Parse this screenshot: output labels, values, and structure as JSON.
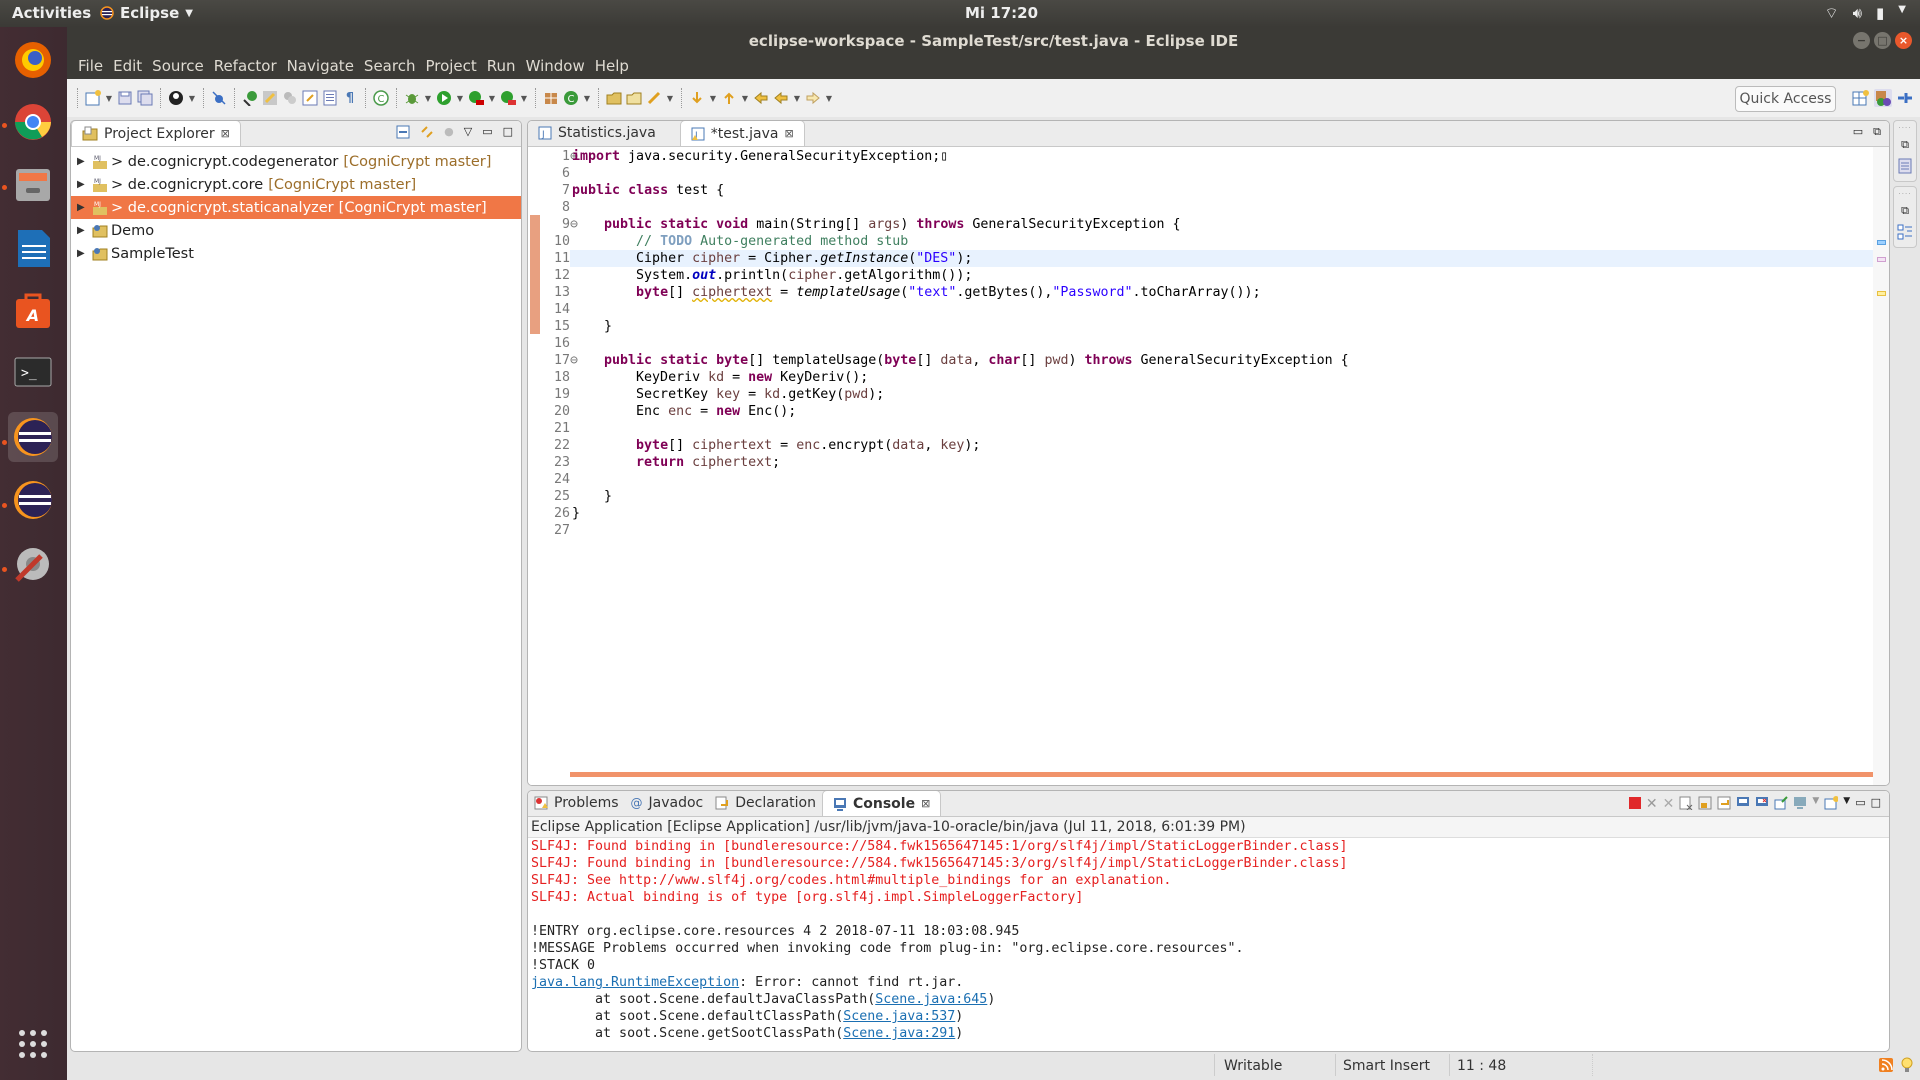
{
  "topbar": {
    "activities": "Activities",
    "app_name": "Eclipse",
    "clock": "Mi 17:20",
    "tray": [
      "wifi-icon",
      "volume-icon",
      "battery-icon",
      "system-menu-icon"
    ]
  },
  "dock": {
    "items": [
      {
        "name": "firefox",
        "running": false,
        "active": false,
        "color": "#e66000"
      },
      {
        "name": "chrome",
        "running": true,
        "active": false,
        "color": "#4285f4"
      },
      {
        "name": "files",
        "running": true,
        "active": false,
        "color": "#9a9a9a"
      },
      {
        "name": "libreoffice-writer",
        "running": false,
        "active": false,
        "color": "#1e6fb7"
      },
      {
        "name": "software-center",
        "running": false,
        "active": false,
        "color": "#e95420"
      },
      {
        "name": "terminal",
        "running": false,
        "active": false,
        "color": "#2b2b2b"
      },
      {
        "name": "eclipse",
        "running": true,
        "active": true,
        "color": "#2c2255"
      },
      {
        "name": "eclipse-2",
        "running": true,
        "active": false,
        "color": "#2c2255"
      },
      {
        "name": "system-tools",
        "running": true,
        "active": false,
        "color": "#c0392b"
      }
    ],
    "show_apps": "show-applications-icon"
  },
  "window": {
    "title": "eclipse-workspace - SampleTest/src/test.java - Eclipse IDE"
  },
  "menu": [
    "File",
    "Edit",
    "Source",
    "Refactor",
    "Navigate",
    "Search",
    "Project",
    "Run",
    "Window",
    "Help"
  ],
  "toolbar": {
    "quick_access": "Quick Access"
  },
  "explorer": {
    "title": "Project Explorer",
    "items": [
      {
        "label": "> de.cognicrypt.codegenerator",
        "branch": "[CogniCrypt master]",
        "selected": false
      },
      {
        "label": "> de.cognicrypt.core",
        "branch": "[CogniCrypt master]",
        "selected": false
      },
      {
        "label": "> de.cognicrypt.staticanalyzer",
        "branch": "[CogniCrypt master]",
        "selected": true
      },
      {
        "label": "Demo",
        "branch": "",
        "selected": false
      },
      {
        "label": "SampleTest",
        "branch": "",
        "selected": false
      }
    ]
  },
  "editor": {
    "tabs": [
      {
        "label": "Statistics.java",
        "active": false
      },
      {
        "label": "*test.java",
        "active": true
      }
    ],
    "lines": [
      {
        "n": "1",
        "fold": "+",
        "html": "<span class='kw'>import</span> java.security.GeneralSecurityException;▯"
      },
      {
        "n": "6",
        "html": ""
      },
      {
        "n": "7",
        "html": "<span class='kw'>public</span> <span class='kw'>class</span> test {"
      },
      {
        "n": "8",
        "html": ""
      },
      {
        "n": "9",
        "fold": "-",
        "html": "    <span class='kw'>public</span> <span class='kw'>static</span> <span class='kw'>void</span> main(String[] <span class='var'>args</span>) <span class='kw'>throws</span> GeneralSecurityException {"
      },
      {
        "n": "10",
        "html": "        <span class='cm'>// <span class='todo'>TODO</span> Auto-generated method stub</span>"
      },
      {
        "n": "11",
        "cur": true,
        "html": "        Cipher <span class='var'>cipher</span> = Cipher.<span class='it'>getInstance</span>(<span class='str'>\"DES\"</span>);"
      },
      {
        "n": "12",
        "html": "        System.<span class='fld'>out</span>.println(<span class='var'>cipher</span>.getAlgorithm());"
      },
      {
        "n": "13",
        "html": "        <span class='kw'>byte</span>[] <span class='var warn'>ciphertext</span> = <span class='it'>templateUsage</span>(<span class='str'>\"text\"</span>.getBytes(),<span class='str'>\"Password\"</span>.toCharArray());"
      },
      {
        "n": "14",
        "html": ""
      },
      {
        "n": "15",
        "html": "    }"
      },
      {
        "n": "16",
        "html": ""
      },
      {
        "n": "17",
        "fold": "-",
        "html": "    <span class='kw'>public</span> <span class='kw'>static</span> <span class='kw'>byte</span>[] templateUsage(<span class='kw'>byte</span>[] <span class='var'>data</span>, <span class='kw'>char</span>[] <span class='var'>pwd</span>) <span class='kw'>throws</span> GeneralSecurityException {"
      },
      {
        "n": "18",
        "html": "        KeyDeriv <span class='var'>kd</span> = <span class='kw'>new</span> KeyDeriv();"
      },
      {
        "n": "19",
        "html": "        SecretKey <span class='var'>key</span> = <span class='var'>kd</span>.getKey(<span class='var'>pwd</span>);"
      },
      {
        "n": "20",
        "html": "        Enc <span class='var'>enc</span> = <span class='kw'>new</span> Enc();"
      },
      {
        "n": "21",
        "html": ""
      },
      {
        "n": "22",
        "html": "        <span class='kw'>byte</span>[] <span class='var'>ciphertext</span> = <span class='var'>enc</span>.encrypt(<span class='var'>data</span>, <span class='var'>key</span>);"
      },
      {
        "n": "23",
        "html": "        <span class='kw'>return</span> <span class='var'>ciphertext</span>;"
      },
      {
        "n": "24",
        "html": ""
      },
      {
        "n": "25",
        "html": "    }"
      },
      {
        "n": "26",
        "html": "}"
      },
      {
        "n": "27",
        "html": ""
      }
    ]
  },
  "bottom": {
    "tabs": [
      {
        "label": "Problems",
        "active": false
      },
      {
        "label": "Javadoc",
        "active": false
      },
      {
        "label": "Declaration",
        "active": false
      },
      {
        "label": "Console",
        "active": true
      }
    ],
    "console_header": "Eclipse Application [Eclipse Application] /usr/lib/jvm/java-10-oracle/bin/java (Jul 11, 2018, 6:01:39 PM)",
    "lines": [
      {
        "type": "err",
        "text": "SLF4J: Found binding in [bundleresource://584.fwk1565647145:1/org/slf4j/impl/StaticLoggerBinder.class]"
      },
      {
        "type": "err",
        "text": "SLF4J: Found binding in [bundleresource://584.fwk1565647145:3/org/slf4j/impl/StaticLoggerBinder.class]"
      },
      {
        "type": "err",
        "text": "SLF4J: See http://www.slf4j.org/codes.html#multiple_bindings for an explanation."
      },
      {
        "type": "err",
        "text": "SLF4J: Actual binding is of type [org.slf4j.impl.SimpleLoggerFactory]"
      },
      {
        "type": "out",
        "text": ""
      },
      {
        "type": "out",
        "text": "!ENTRY org.eclipse.core.resources 4 2 2018-07-11 18:03:08.945"
      },
      {
        "type": "out",
        "text": "!MESSAGE Problems occurred when invoking code from plug-in: \"org.eclipse.core.resources\"."
      },
      {
        "type": "out",
        "text": "!STACK 0"
      },
      {
        "type": "out",
        "link": "java.lang.RuntimeException",
        "text": ": Error: cannot find rt.jar."
      },
      {
        "type": "out",
        "prefix": "        at soot.Scene.defaultJavaClassPath(",
        "link": "Scene.java:645",
        "text": ")"
      },
      {
        "type": "out",
        "prefix": "        at soot.Scene.defaultClassPath(",
        "link": "Scene.java:537",
        "text": ")"
      },
      {
        "type": "out",
        "prefix": "        at soot.Scene.getSootClassPath(",
        "link": "Scene.java:291",
        "text": ")"
      }
    ]
  },
  "status": {
    "writable": "Writable",
    "insert_mode": "Smart Insert",
    "position": "11 : 48"
  },
  "colors": {
    "selection": "#f07746",
    "error_marker": "#f1936a",
    "console_error": "#e52020",
    "keyword": "#7f0055",
    "string": "#2a00ff",
    "comment": "#3f7f5f"
  }
}
